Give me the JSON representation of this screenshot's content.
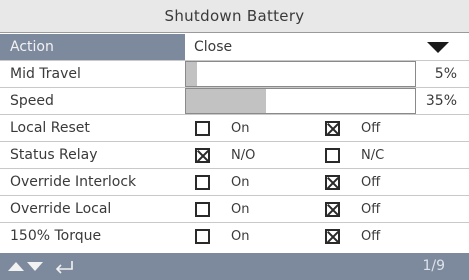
{
  "title": "Shutdown Battery",
  "action": {
    "label": "Action",
    "value": "Close"
  },
  "mid_travel": {
    "label": "Mid Travel",
    "percent_text": "5%",
    "fill_fraction": 0.05
  },
  "speed": {
    "label": "Speed",
    "percent_text": "35%",
    "fill_fraction": 0.35
  },
  "checkbox_rows": [
    {
      "label": "Local Reset",
      "opt1": "On",
      "opt1_checked": false,
      "opt2": "Off",
      "opt2_checked": true
    },
    {
      "label": "Status Relay",
      "opt1": "N/O",
      "opt1_checked": true,
      "opt2": "N/C",
      "opt2_checked": false
    },
    {
      "label": "Override Interlock",
      "opt1": "On",
      "opt1_checked": false,
      "opt2": "Off",
      "opt2_checked": true
    },
    {
      "label": "Override Local",
      "opt1": "On",
      "opt1_checked": false,
      "opt2": "Off",
      "opt2_checked": true
    },
    {
      "label": "150% Torque",
      "opt1": "On",
      "opt1_checked": false,
      "opt2": "Off",
      "opt2_checked": true
    }
  ],
  "footer": {
    "page_indicator": "1/9"
  },
  "colors": {
    "accent": "#7d8a9e",
    "title_bg": "#e8e8e8",
    "bar_fill": "#c2c2c2"
  },
  "icons": [
    "chevron-down-icon",
    "up-arrow-icon",
    "down-arrow-icon",
    "enter-icon"
  ]
}
